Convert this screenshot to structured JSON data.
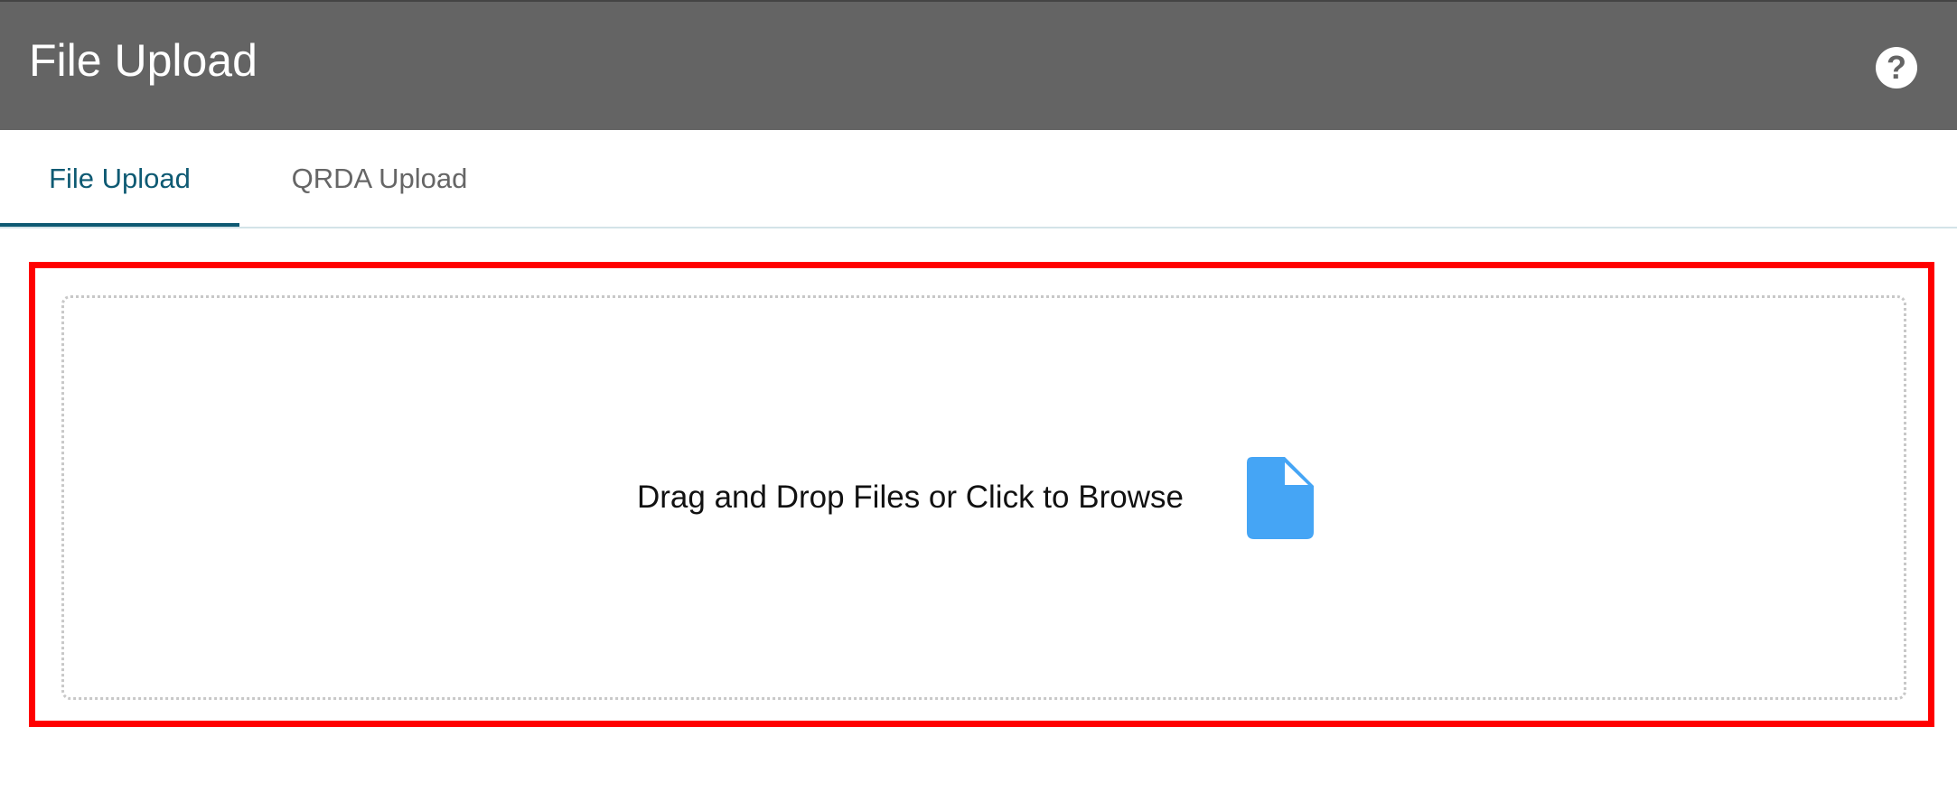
{
  "header": {
    "title": "File Upload",
    "help_icon": "question-circle-icon",
    "help_glyph": "?"
  },
  "tabs": [
    {
      "label": "File Upload",
      "active": true
    },
    {
      "label": "QRDA Upload",
      "active": false
    }
  ],
  "dropzone": {
    "text": "Drag and Drop Files or Click to Browse",
    "icon": "file-icon",
    "icon_color": "#45a5f5",
    "highlight_color": "#ff0000"
  },
  "colors": {
    "header_bg": "#646464",
    "active_tab": "#0e5a73",
    "inactive_tab": "#666666"
  }
}
